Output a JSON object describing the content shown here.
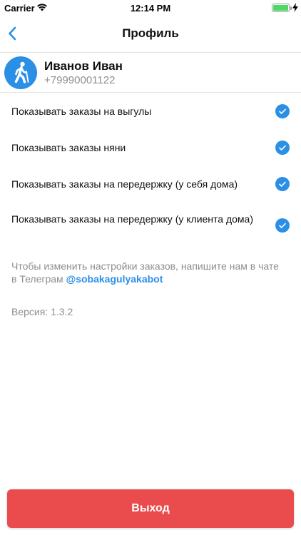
{
  "status_bar": {
    "carrier": "Carrier",
    "time": "12:14 PM",
    "wifi_icon": "wifi-icon",
    "battery_icon": "battery-icon",
    "charging_icon": "charging-bolt-icon"
  },
  "nav": {
    "back_icon": "chevron-left-icon",
    "title": "Профиль"
  },
  "profile": {
    "avatar_icon": "walking-person-icon",
    "name": "Иванов Иван",
    "phone": "+79990001122"
  },
  "settings": [
    {
      "label": "Показывать заказы на выгулы",
      "checked": true
    },
    {
      "label": "Показывать заказы няни",
      "checked": true
    },
    {
      "label": "Показывать заказы на передержку (у себя дома)",
      "checked": true
    },
    {
      "label": "Показывать заказы на передержку (у клиента дома)",
      "checked": true
    }
  ],
  "info": {
    "text": "Чтобы изменить настройки заказов, напишите нам в чате в Телеграм ",
    "link": "@sobakagulyakabot"
  },
  "version": "Версия: 1.3.2",
  "logout_label": "Выход",
  "colors": {
    "accent": "#2c8fe6",
    "danger": "#ea4c4d",
    "secondary_text": "#8e8e93",
    "battery": "#4cd964"
  }
}
